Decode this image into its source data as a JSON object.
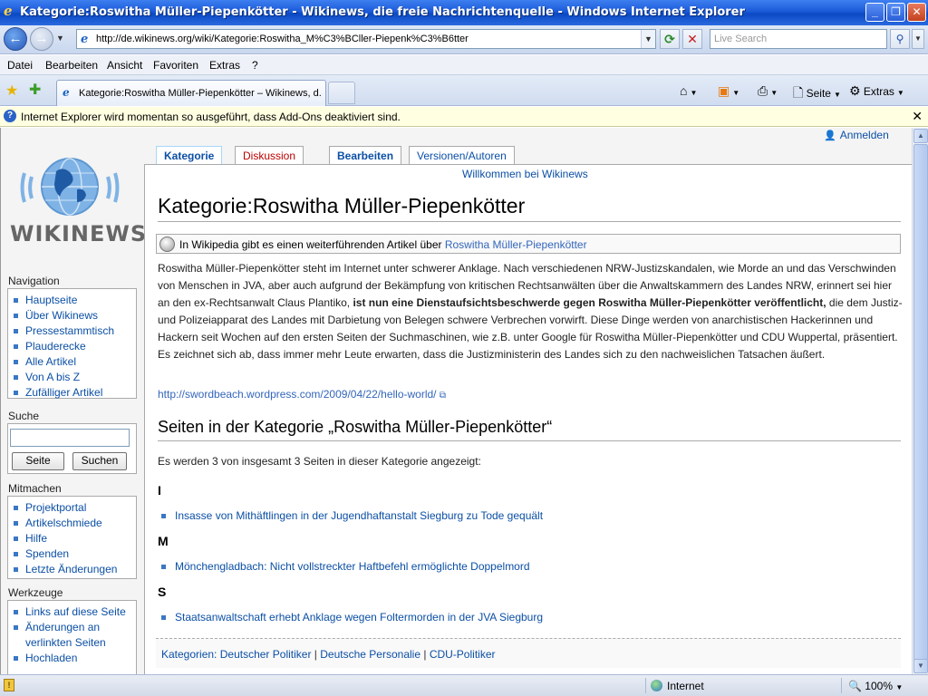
{
  "window": {
    "title": "Kategorie:Roswitha Müller-Piepenkötter - Wikinews, die freie Nachrichtenquelle - Windows Internet Explorer",
    "minimize": "_",
    "restore": "❐",
    "close": "✕"
  },
  "address": {
    "url": "http://de.wikinews.org/wiki/Kategorie:Roswitha_M%C3%BCller-Piepenk%C3%B6tter",
    "search_placeholder": "Live Search"
  },
  "menu": [
    "Datei",
    "Bearbeiten",
    "Ansicht",
    "Favoriten",
    "Extras",
    "?"
  ],
  "tabbar": {
    "tab_label": "Kategorie:Roswitha Müller-Piepenkötter – Wikinews, d...",
    "page_label": "Seite",
    "tools_label": "Extras"
  },
  "infobar": {
    "message": "Internet Explorer wird momentan so ausgeführt, dass Add-Ons deaktiviert sind."
  },
  "user": {
    "login": "Anmelden"
  },
  "logo": {
    "text": "WIKINEWS"
  },
  "sidebar": {
    "navigation": {
      "heading": "Navigation",
      "items": [
        "Hauptseite",
        "Über Wikinews",
        "Pressestammtisch",
        "Plauderecke",
        "Alle Artikel",
        "Von A bis Z",
        "Zufälliger Artikel"
      ]
    },
    "search": {
      "heading": "Suche",
      "go": "Seite",
      "search": "Suchen"
    },
    "participate": {
      "heading": "Mitmachen",
      "items": [
        "Projektportal",
        "Artikelschmiede",
        "Hilfe",
        "Spenden",
        "Letzte Änderungen"
      ]
    },
    "tools": {
      "heading": "Werkzeuge",
      "items": [
        "Links auf diese Seite",
        "Änderungen an verlinkten Seiten",
        "Hochladen"
      ]
    }
  },
  "page_tabs": [
    "Kategorie",
    "Diskussion",
    "Bearbeiten",
    "Versionen/Autoren"
  ],
  "content": {
    "welcome": "Willkommen bei Wikinews",
    "title": "Kategorie:Roswitha Müller-Piepenkötter",
    "wikipedia_prefix": "In Wikipedia gibt es einen weiterführenden Artikel über",
    "wikipedia_link": "Roswitha Müller-Piepenkötter",
    "paragraph_part1": "Roswitha Müller-Piepenkötter steht im Internet unter schwerer Anklage. Nach verschiedenen NRW-Justizskandalen, wie Morde an und das Verschwinden von Menschen in JVA, aber auch aufgrund der Bekämpfung von kritischen Rechtsanwälten über die Anwaltskammern des Landes NRW, erinnert sei hier an den ex-Rechtsanwalt Claus Plantiko,",
    "paragraph_bold": "ist nun eine Dienstaufsichtsbeschwerde gegen Roswitha Müller-Piepenkötter veröffentlicht,",
    "paragraph_part2": "die dem Justiz- und Polizeiapparat des Landes mit Darbietung von Belegen schwere Verbrechen vorwirft. Diese Dinge werden von anarchistischen Hackerinnen und Hackern seit Wochen auf den ersten Seiten der Suchmaschinen, wie z.B. unter Google für Roswitha Müller-Piepenkötter und CDU Wuppertal, präsentiert. Es zeichnet sich ab, dass immer mehr Leute erwarten, dass die Justizministerin des Landes sich zu den nachweislichen Tatsachen äußert.",
    "external_link": "http://swordbeach.wordpress.com/2009/04/22/hello-world/",
    "section_title": "Seiten in der Kategorie „Roswitha Müller-Piepenkötter“",
    "count_text": "Es werden 3 von insgesamt 3 Seiten in dieser Kategorie angezeigt:",
    "groups": [
      {
        "letter": "I",
        "page": "Insasse von Mithäftlingen in der Jugendhaftanstalt Siegburg zu Tode gequält"
      },
      {
        "letter": "M",
        "page": "Mönchengladbach: Nicht vollstreckter Haftbefehl ermöglichte Doppelmord"
      },
      {
        "letter": "S",
        "page": "Staatsanwaltschaft erhebt Anklage wegen Foltermorden in der JVA Siegburg"
      }
    ],
    "categories_label": "Kategorien:",
    "categories": [
      "Deutscher Politiker",
      "Deutsche Personalie",
      "CDU-Politiker"
    ],
    "category_separator": "|"
  },
  "status": {
    "zone": "Internet",
    "zoom": "100%"
  }
}
